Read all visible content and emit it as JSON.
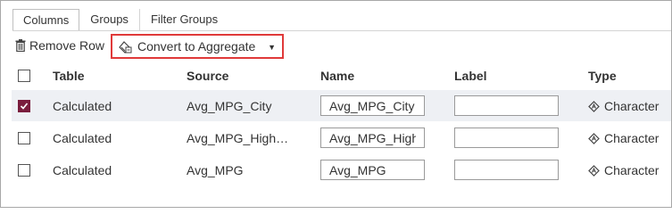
{
  "tabs": [
    {
      "label": "Columns",
      "active": true
    },
    {
      "label": "Groups",
      "active": false
    },
    {
      "label": "Filter Groups",
      "active": false
    }
  ],
  "toolbar": {
    "remove_row_label": "Remove Row",
    "remove_row_icon": "trash-icon",
    "convert_label": "Convert to Aggregate",
    "convert_icon": "aggregate-calculator-icon",
    "highlight_color": "#e03a3a"
  },
  "table": {
    "headers": {
      "table": "Table",
      "source": "Source",
      "name": "Name",
      "label": "Label",
      "type": "Type"
    },
    "rows": [
      {
        "checked": true,
        "table": "Calculated",
        "source": "Avg_MPG_City",
        "name": "Avg_MPG_City",
        "label": "",
        "type": "Character"
      },
      {
        "checked": false,
        "table": "Calculated",
        "source": "Avg_MPG_High…",
        "name": "Avg_MPG_Highway",
        "label": "",
        "type": "Character"
      },
      {
        "checked": false,
        "table": "Calculated",
        "source": "Avg_MPG",
        "name": "Avg_MPG",
        "label": "",
        "type": "Character"
      }
    ]
  },
  "colors": {
    "checkbox_checked": "#7a1d3d",
    "selected_row": "#eef0f4"
  }
}
